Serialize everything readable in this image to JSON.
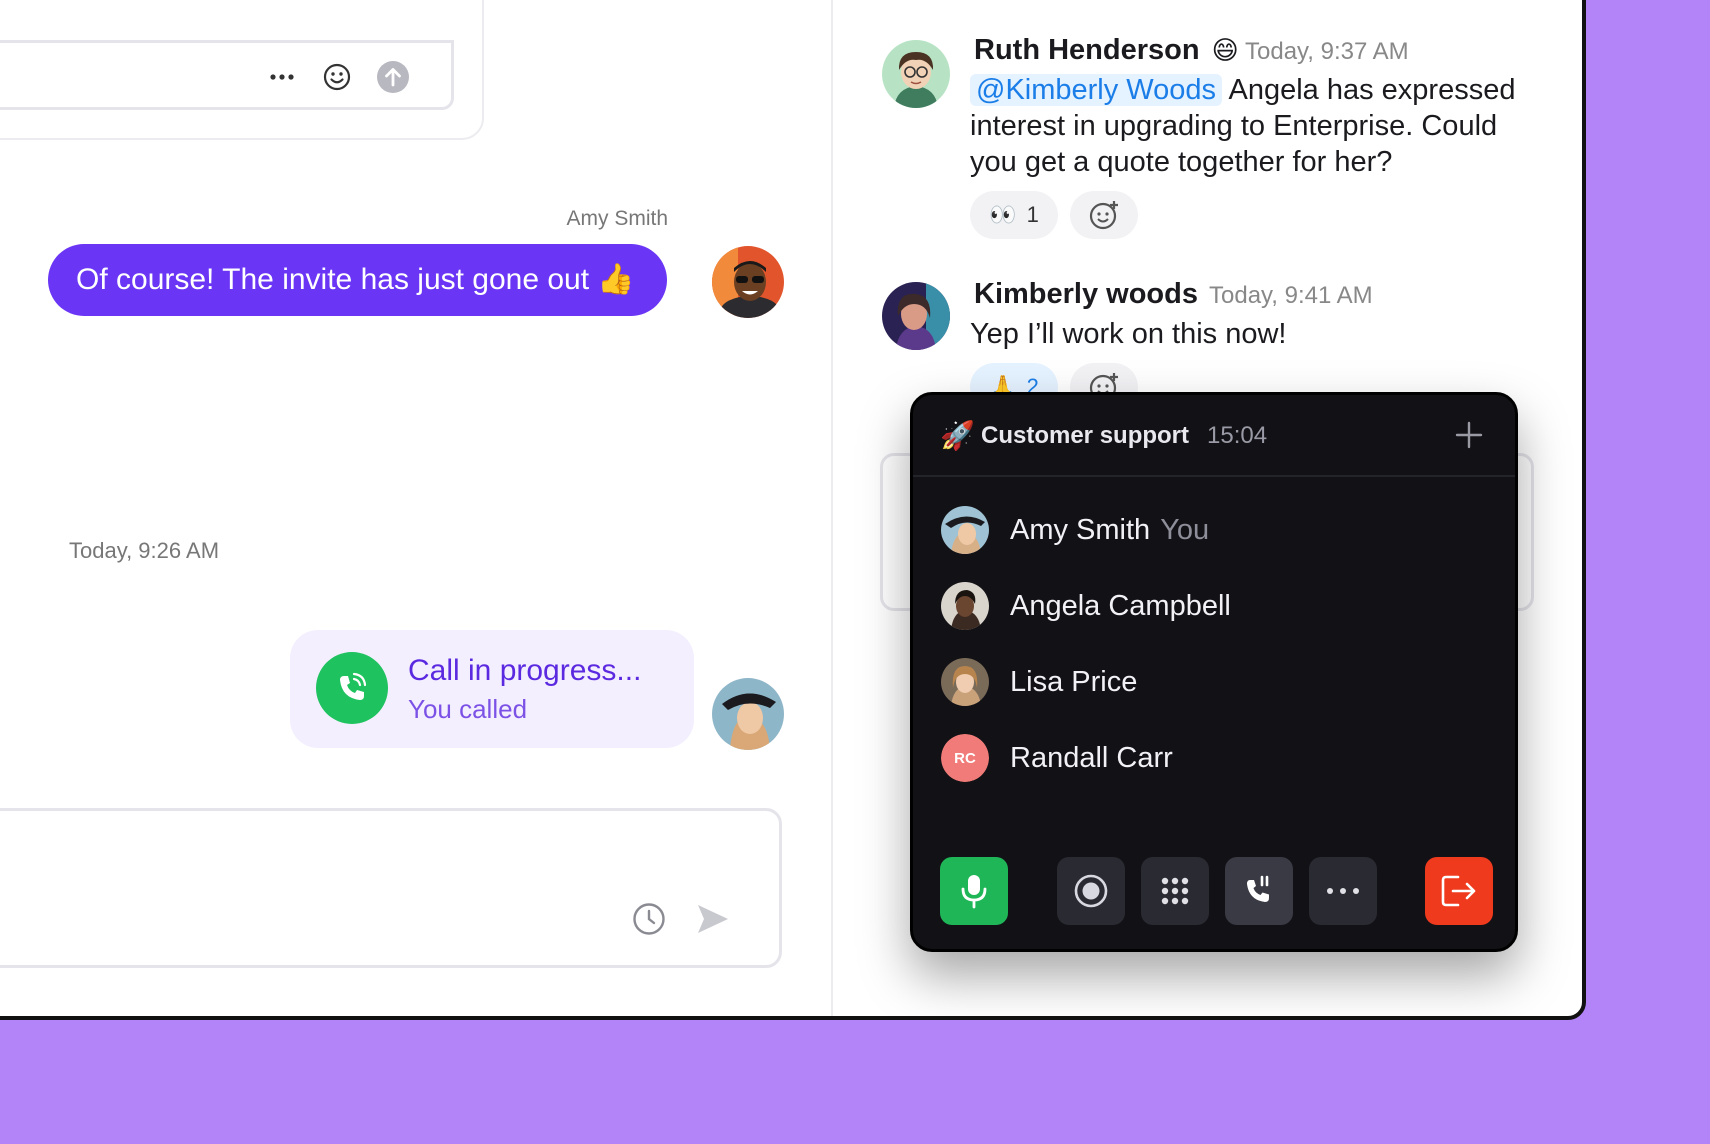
{
  "thread_reply": {
    "more_icon": "more-horizontal-icon",
    "emoji_icon": "emoji-icon",
    "send_icon": "arrow-up-circle-icon"
  },
  "chat": {
    "outgoing_sender": "Amy Smith",
    "outgoing_message": "Of course! The invite has just gone out 👍",
    "timestamp": "Today, 9:26 AM",
    "call_card": {
      "title": "Call in progress...",
      "subtitle": "You called"
    },
    "composer": {
      "schedule_icon": "clock-icon",
      "send_icon": "send-icon"
    }
  },
  "channel": {
    "messages": [
      {
        "author": "Ruth Henderson",
        "status_emoji": "😄",
        "time": "Today, 9:37 AM",
        "mention": "@Kimberly Woods",
        "text": " Angela has expressed interest in upgrading to Enterprise. Could you get a quote together for her?",
        "reaction_emoji": "👀",
        "reaction_count": "1"
      },
      {
        "author": "Kimberly woods",
        "time": "Today, 9:41 AM",
        "text": "Yep I’ll work on this now!",
        "reaction_emoji": "🙏",
        "reaction_count": "2"
      }
    ]
  },
  "call_popup": {
    "emoji": "🚀",
    "title": "Customer support",
    "timer": "15:04",
    "participants": [
      {
        "name": "Amy Smith",
        "tag": "You"
      },
      {
        "name": "Angela Campbell"
      },
      {
        "name": "Lisa Price"
      },
      {
        "name": "Randall Carr",
        "initials": "RC"
      }
    ],
    "controls": [
      "mic-icon",
      "record-icon",
      "dialpad-icon",
      "transfer-call-icon",
      "more-horizontal-icon",
      "leave-call-icon"
    ]
  },
  "colors": {
    "background": "#b284f7",
    "accent": "#6a35f5",
    "call_green": "#1ec25e",
    "leave_red": "#f03a1e"
  }
}
